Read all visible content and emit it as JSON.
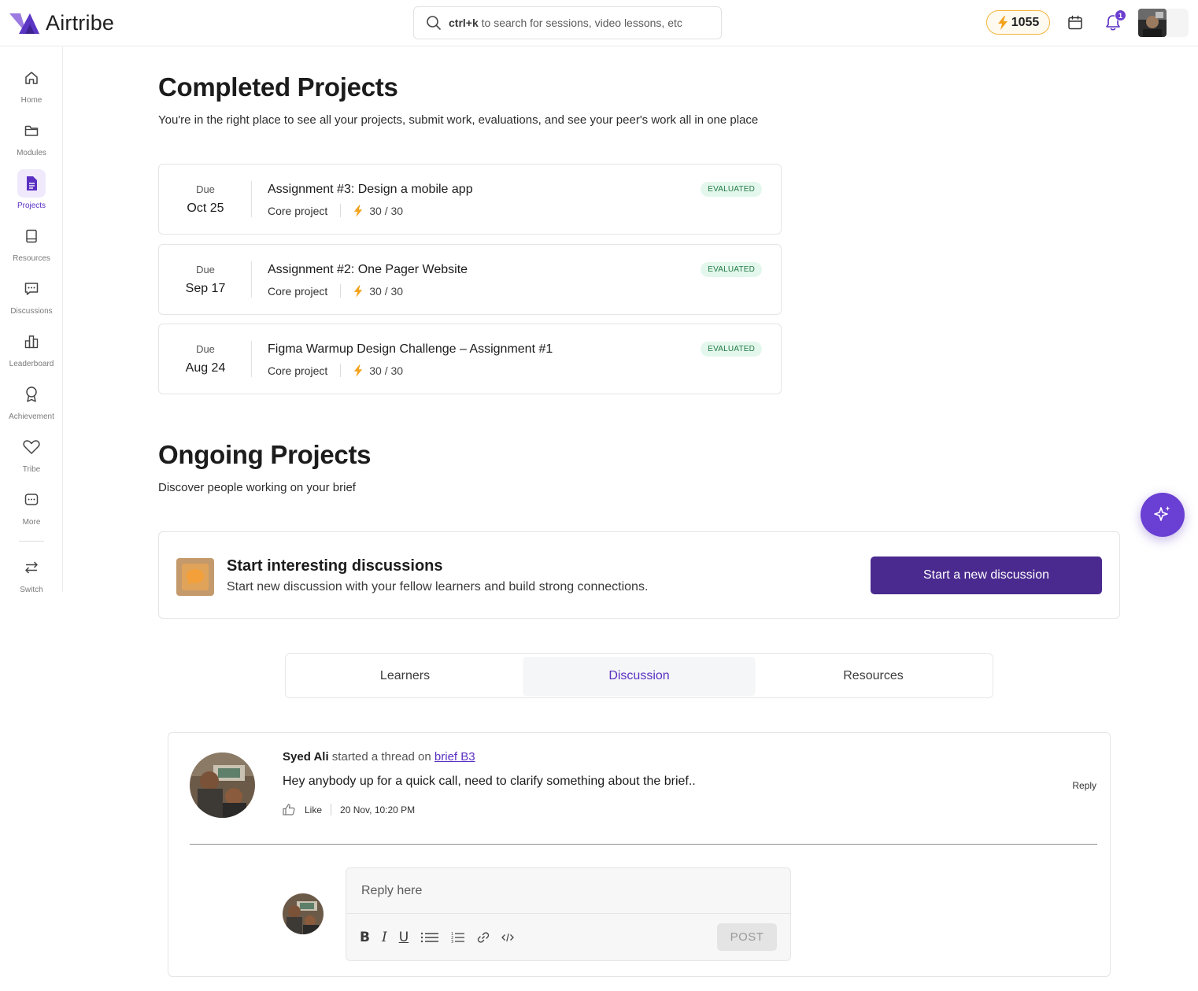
{
  "app": {
    "brand": "Airtribe",
    "search_placeholder_key": "ctrl+k",
    "search_placeholder_rest": " to search for sessions, video lessons, etc",
    "streak": "1055",
    "notification_count": "1"
  },
  "sidebar": {
    "items": [
      {
        "label": "Home",
        "icon": "home-icon"
      },
      {
        "label": "Modules",
        "icon": "folder-icon"
      },
      {
        "label": "Projects",
        "icon": "document-icon",
        "active": true
      },
      {
        "label": "Resources",
        "icon": "book-icon"
      },
      {
        "label": "Discussions",
        "icon": "chat-icon"
      },
      {
        "label": "Leaderboard",
        "icon": "bar-chart-icon"
      },
      {
        "label": "Achievement",
        "icon": "award-icon"
      },
      {
        "label": "Tribe",
        "icon": "heart-icon"
      },
      {
        "label": "More",
        "icon": "more-icon"
      },
      {
        "label": "Switch",
        "icon": "switch-icon"
      }
    ]
  },
  "completed": {
    "title": "Completed Projects",
    "subtitle": "You're in the right place to see all your projects, submit work, evaluations, and see your peer's work all in one place",
    "projects": [
      {
        "due_label": "Due",
        "due_date": "Oct 25",
        "title": "Assignment #3: Design a mobile app",
        "type": "Core project",
        "score": "30 / 30",
        "status": "EVALUATED"
      },
      {
        "due_label": "Due",
        "due_date": "Sep 17",
        "title": "Assignment #2: One Pager Website",
        "type": "Core project",
        "score": "30 / 30",
        "status": "EVALUATED"
      },
      {
        "due_label": "Due",
        "due_date": "Aug 24",
        "title": "Figma Warmup Design Challenge – Assignment #1",
        "type": "Core project",
        "score": "30 / 30",
        "status": "EVALUATED"
      }
    ]
  },
  "ongoing": {
    "title": "Ongoing Projects",
    "subtitle": "Discover people working on your brief"
  },
  "banner": {
    "title": "Start interesting discussions",
    "subtitle": "Start new discussion with your fellow learners and build strong connections.",
    "button": "Start a new discussion"
  },
  "tabs": {
    "items": [
      "Learners",
      "Discussion",
      "Resources"
    ],
    "active": "Discussion"
  },
  "thread": {
    "author": "Syed Ali",
    "action": " started a thread on ",
    "link": "brief B3",
    "message": "Hey anybody up for a quick call, need to clarify something about the brief..",
    "like": "Like",
    "timestamp": "20 Nov, 10:20 PM",
    "reply": "Reply",
    "reply_placeholder": "Reply here",
    "post": "POST"
  },
  "colors": {
    "accent": "#5a2fc2",
    "primary_button": "#4a2a8f",
    "evaluated_bg": "#e4f7ec",
    "evaluated_text": "#1f7a44",
    "streak_border": "#f2b53c"
  }
}
